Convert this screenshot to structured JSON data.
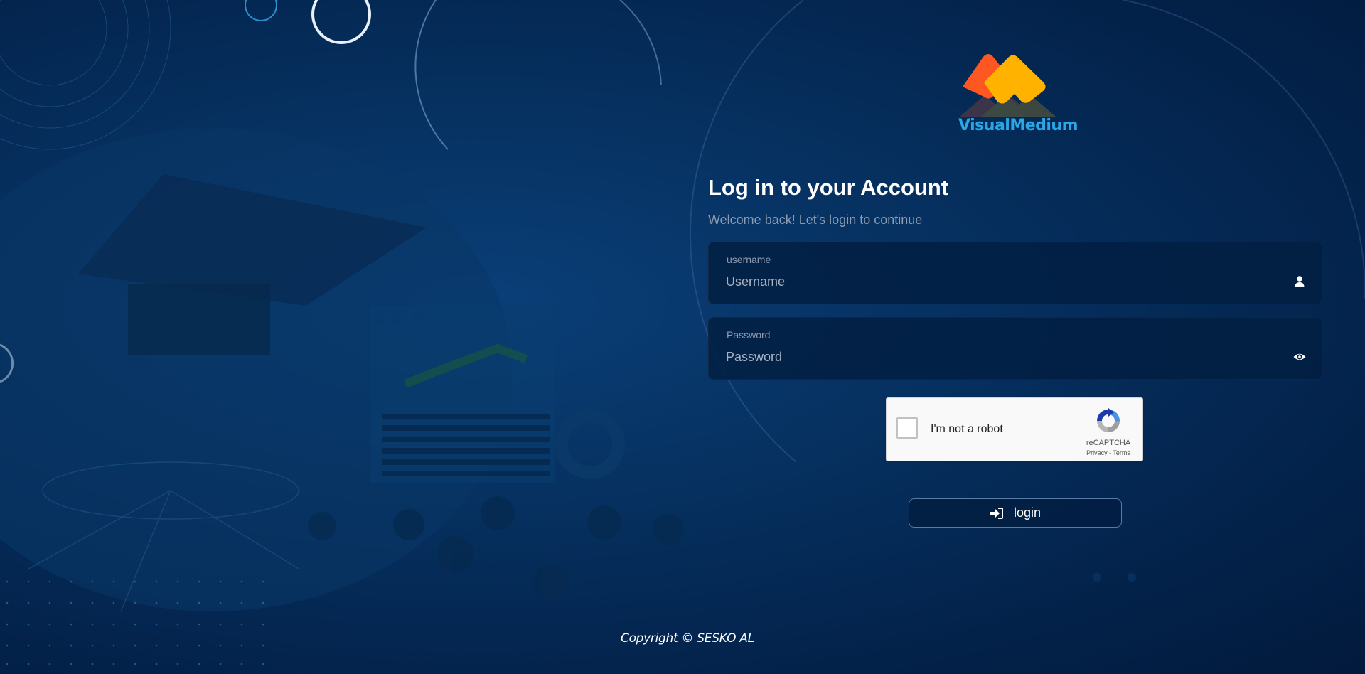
{
  "brand": {
    "name": "VisualMedium",
    "colors": {
      "orange": "#ff5722",
      "yellow": "#ffb300",
      "text": "#29a7e6"
    }
  },
  "login": {
    "title": "Log in to your Account",
    "subtitle": "Welcome back! Let's login to continue",
    "username": {
      "label": "username",
      "placeholder": "Username",
      "value": "",
      "icon": "user-icon"
    },
    "password": {
      "label": "Password",
      "placeholder": "Password",
      "value": "",
      "icon": "eye-icon"
    },
    "button": {
      "label": "login",
      "icon": "sign-in-icon"
    }
  },
  "recaptcha": {
    "label": "I'm not a robot",
    "brand": "reCAPTCHA",
    "privacy": "Privacy",
    "separator": " - ",
    "terms": "Terms",
    "checked": false
  },
  "footer": {
    "copyright": "Copyright © SESKO AL"
  }
}
